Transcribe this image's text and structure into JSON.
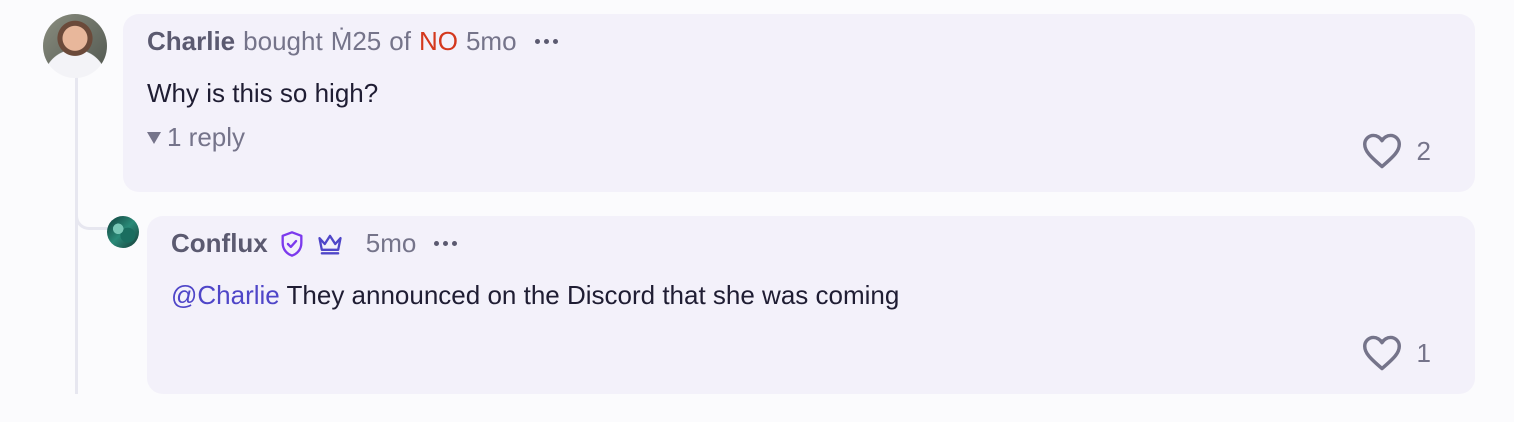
{
  "colors": {
    "card_bg": "#f3f1fa",
    "outcome_no": "#d4381d",
    "mention": "#4f46c8",
    "muted": "#75748a",
    "badge_purple": "#7c3aed"
  },
  "comments": [
    {
      "author": "Charlie",
      "action": "bought",
      "amount": "Ṁ25",
      "of": "of",
      "outcome": "NO",
      "time": "5mo",
      "text": "Why is this so high?",
      "replies_label": "1 reply",
      "likes": "2",
      "avatar_icon": "user-avatar",
      "more_icon": "more-horizontal-icon"
    }
  ],
  "reply": {
    "author": "Conflux",
    "badges": [
      "shield-check-icon",
      "crown-icon"
    ],
    "time": "5mo",
    "mention": "@Charlie",
    "text": " They announced on the Discord that she was coming",
    "likes": "1",
    "avatar_icon": "user-avatar",
    "more_icon": "more-horizontal-icon"
  }
}
